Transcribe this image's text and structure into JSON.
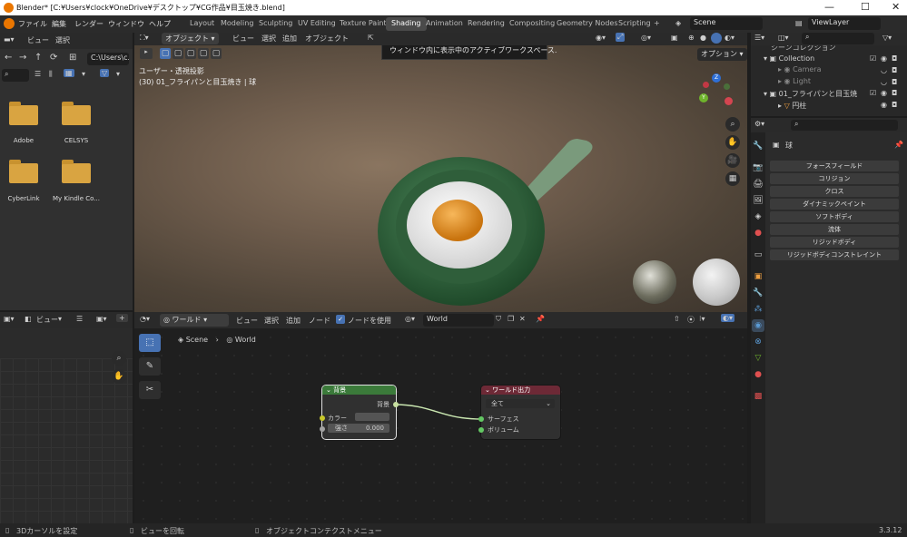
{
  "window": {
    "title": "Blender* [C:¥Users¥clock¥OneDrive¥デスクトップ¥CG作品¥目玉焼き.blend]"
  },
  "menu": [
    "ファイル",
    "編集",
    "レンダー",
    "ウィンドウ",
    "ヘルプ"
  ],
  "workspaces": [
    "Layout",
    "Modeling",
    "Sculpting",
    "UV Editing",
    "Texture Paint",
    "Shading",
    "Animation",
    "Rendering",
    "Compositing",
    "Geometry Nodes",
    "Scripting"
  ],
  "workspace_add": "+",
  "scene": {
    "label": "Scene"
  },
  "viewlayer": {
    "label": "ViewLayer"
  },
  "filebrowser": {
    "header": [
      "ビュー",
      "選択"
    ],
    "path": "C:\\Users\\c...",
    "items": [
      "Adobe",
      "CELSYS",
      "CyberLink",
      "My Kindle Co..."
    ]
  },
  "viewport": {
    "mode": "オブジェクト",
    "menus": [
      "ビュー",
      "選択",
      "追加",
      "オブジェクト"
    ],
    "tooltip": "ウィンドウ内に表示中のアクティブワークスペース.",
    "info_line1": "ユーザー・透視投影",
    "info_line2": "(30) 01_フライパンと目玉焼き | 球",
    "options": "オプション"
  },
  "outliner": {
    "title": "シーンコレクション",
    "items": [
      "Collection",
      "Camera",
      "Light",
      "01_フライパンと目玉焼",
      "円柱"
    ]
  },
  "properties": {
    "object": "球",
    "physics": [
      "フォースフィールド",
      "コリジョン",
      "クロス",
      "ダイナミックペイント",
      "ソフトボディ",
      "流体",
      "リジッドボディ",
      "リジッドボディコンストレイント"
    ]
  },
  "image_editor": {
    "view": "ビュー"
  },
  "node_editor": {
    "type": "ワールド",
    "menus": [
      "ビュー",
      "選択",
      "追加",
      "ノード"
    ],
    "use_nodes": "ノードを使用",
    "world_name": "World",
    "breadcrumb": [
      "Scene",
      "World"
    ]
  },
  "node_background": {
    "title": "背景",
    "output": "背景",
    "color_label": "カラー",
    "strength_label": "強さ",
    "strength_value": "0.000"
  },
  "node_world_output": {
    "title": "ワールド出力",
    "target": "全て",
    "surface": "サーフェス",
    "volume": "ボリューム"
  },
  "status": {
    "left": "3Dカーソルを設定",
    "mid": "ビューを回転",
    "right": "オブジェクトコンテクストメニュー",
    "version": "3.3.12"
  }
}
